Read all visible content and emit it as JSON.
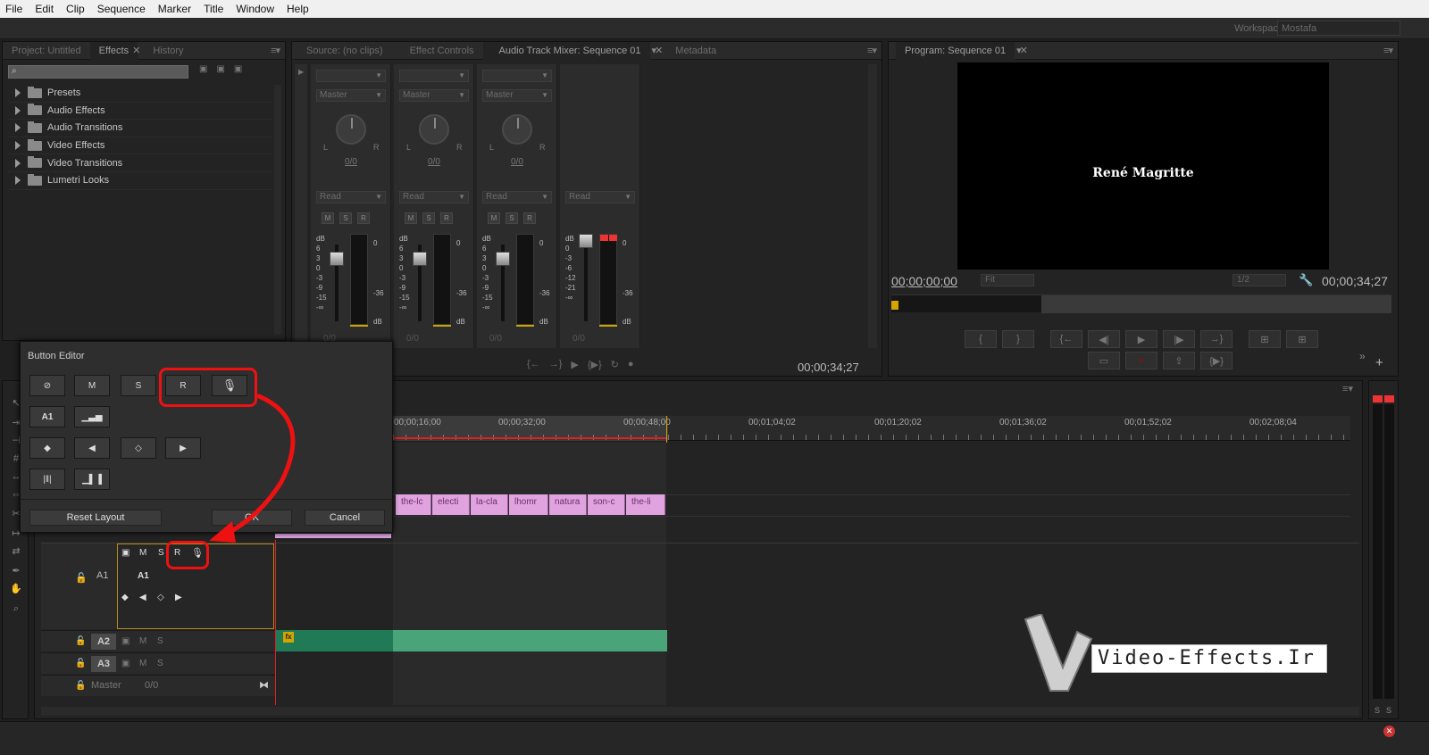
{
  "menu": [
    "File",
    "Edit",
    "Clip",
    "Sequence",
    "Marker",
    "Title",
    "Window",
    "Help"
  ],
  "workspace": {
    "label": "Workspace:",
    "value": "Mostafa"
  },
  "left_panel": {
    "tabs": [
      "Project: Untitled",
      "Effects",
      "History"
    ],
    "active_tab": "Effects",
    "search_placeholder": "",
    "tree": [
      "Presets",
      "Audio Effects",
      "Audio Transitions",
      "Video Effects",
      "Video Transitions",
      "Lumetri Looks"
    ]
  },
  "mid_panel": {
    "tabs": [
      "Source: (no clips)",
      "Effect Controls",
      "Audio Track Mixer: Sequence 01",
      "Metadata"
    ],
    "active_tab": "Audio Track Mixer: Sequence 01",
    "strips": [
      {
        "pan_label": "Master",
        "read": "Read",
        "pan_value": "0/0",
        "level": "0/0"
      },
      {
        "pan_label": "Master",
        "read": "Read",
        "pan_value": "0/0",
        "level": "0/0"
      },
      {
        "pan_label": "Master",
        "read": "Read",
        "pan_value": "0/0",
        "level": "0/0"
      },
      {
        "pan_label": "",
        "read": "Read",
        "pan_value": "",
        "level": "0/0"
      }
    ],
    "msr": [
      "M",
      "S",
      "R"
    ],
    "db_label": "dB",
    "meter_top": "0",
    "meter_mid": "-36",
    "meter_bottom": "dB",
    "db_scale": [
      "6",
      "3",
      "0",
      "-3",
      "-9",
      "-15",
      "-∞"
    ],
    "master_scale": [
      "0",
      "-3",
      "-6",
      "-12",
      "-21",
      "-∞"
    ],
    "left_label": "L",
    "right_label": "R",
    "timecode": "00;00;34;27"
  },
  "program": {
    "tab": "Program: Sequence 01",
    "title_overlay": "René Magritte",
    "current_time": "00;00;00;00",
    "fit": "Fit",
    "resolution": "1/2",
    "duration": "00;00;34;27"
  },
  "button_editor": {
    "title": "Button Editor",
    "row1": [
      "M",
      "S",
      "R"
    ],
    "track_label": "A1",
    "reset": "Reset Layout",
    "ok": "OK",
    "cancel": "Cancel"
  },
  "timeline": {
    "ruler": [
      "00;00;16;00",
      "00;00;32;00",
      "00;00;48;00",
      "00;01;04;02",
      "00;01;20;02",
      "00;01;36;02",
      "00;01;52;02",
      "00;02;08;04"
    ],
    "clips": [
      "the-lc",
      "electi",
      "la-cla",
      "lhomr",
      "natura",
      "son-c",
      "the-li"
    ],
    "tracks": [
      {
        "name": "A1",
        "m": "M",
        "s": "S",
        "r": "R"
      },
      {
        "name": "A2",
        "m": "M",
        "s": "S"
      },
      {
        "name": "A3",
        "m": "M",
        "s": "S"
      }
    ],
    "master": {
      "name": "Master",
      "value": "0/0"
    },
    "fx_badge": "fx"
  },
  "watermark": "Video-Effects.Ir",
  "right_meter_labels": [
    "S",
    "S"
  ],
  "colors": {
    "highlight": "#e11111",
    "clip_pink": "#e0a3e0",
    "clip_green": "#4aa47a",
    "playhead": "#e02020"
  }
}
